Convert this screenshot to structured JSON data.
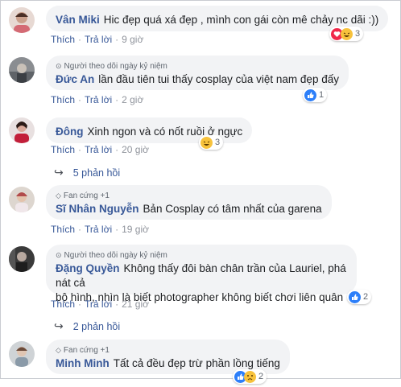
{
  "comments": [
    {
      "author": "Vân Miki",
      "text": "Hic đẹp quá xá đẹp , mình con gái còn mê chảy nc dãi :))",
      "like_label": "Thích",
      "reply_label": "Trả lời",
      "time": "9 giờ",
      "reaction_count": "3",
      "reactions": [
        "heart-icon",
        "haha-icon"
      ]
    },
    {
      "badge": "Người theo dõi ngày kỷ niệm",
      "author": "Đức An",
      "text": "lần đầu tiên tui thấy cosplay của việt nam đẹp đấy",
      "like_label": "Thích",
      "reply_label": "Trả lời",
      "time": "2 giờ",
      "reaction_count": "1",
      "reactions": [
        "like-icon"
      ]
    },
    {
      "author": "Đông",
      "text": "Xinh ngon và có nốt ruồi ở ngực",
      "like_label": "Thích",
      "reply_label": "Trả lời",
      "time": "20 giờ",
      "reaction_count": "3",
      "reactions": [
        "haha-icon"
      ],
      "replies_label": "5 phản hồi"
    },
    {
      "badge": "Fan cứng +1",
      "author": "Sĩ Nhân Nguyễn",
      "text": "Bản Cosplay có tâm nhất của garena",
      "like_label": "Thích",
      "reply_label": "Trả lời",
      "time": "19 giờ"
    },
    {
      "badge": "Người theo dõi ngày kỷ niệm",
      "author": "Đặng Quyền",
      "text": "Không thấy đôi bàn chân trần của Lauriel, phá nát cả",
      "text2": "bộ hình, nhìn là biết photographer không biết chơi liên quân",
      "like_label": "Thích",
      "reply_label": "Trả lời",
      "time": "21 giờ",
      "reaction_count": "2",
      "reactions": [
        "like-icon"
      ],
      "replies_label": "2 phản hồi"
    },
    {
      "badge": "Fan cứng +1",
      "author": "Minh Minh",
      "text": "Tất cả đều đẹp trừ phần lồng tiếng",
      "reaction_count": "2",
      "reactions": [
        "like-icon",
        "sad-icon"
      ]
    }
  ],
  "colors": {
    "link": "#385898",
    "bubble": "#f2f3f5",
    "like": "#2d7ff9",
    "heart": "#f0284a",
    "haha": "#f7c23c"
  }
}
